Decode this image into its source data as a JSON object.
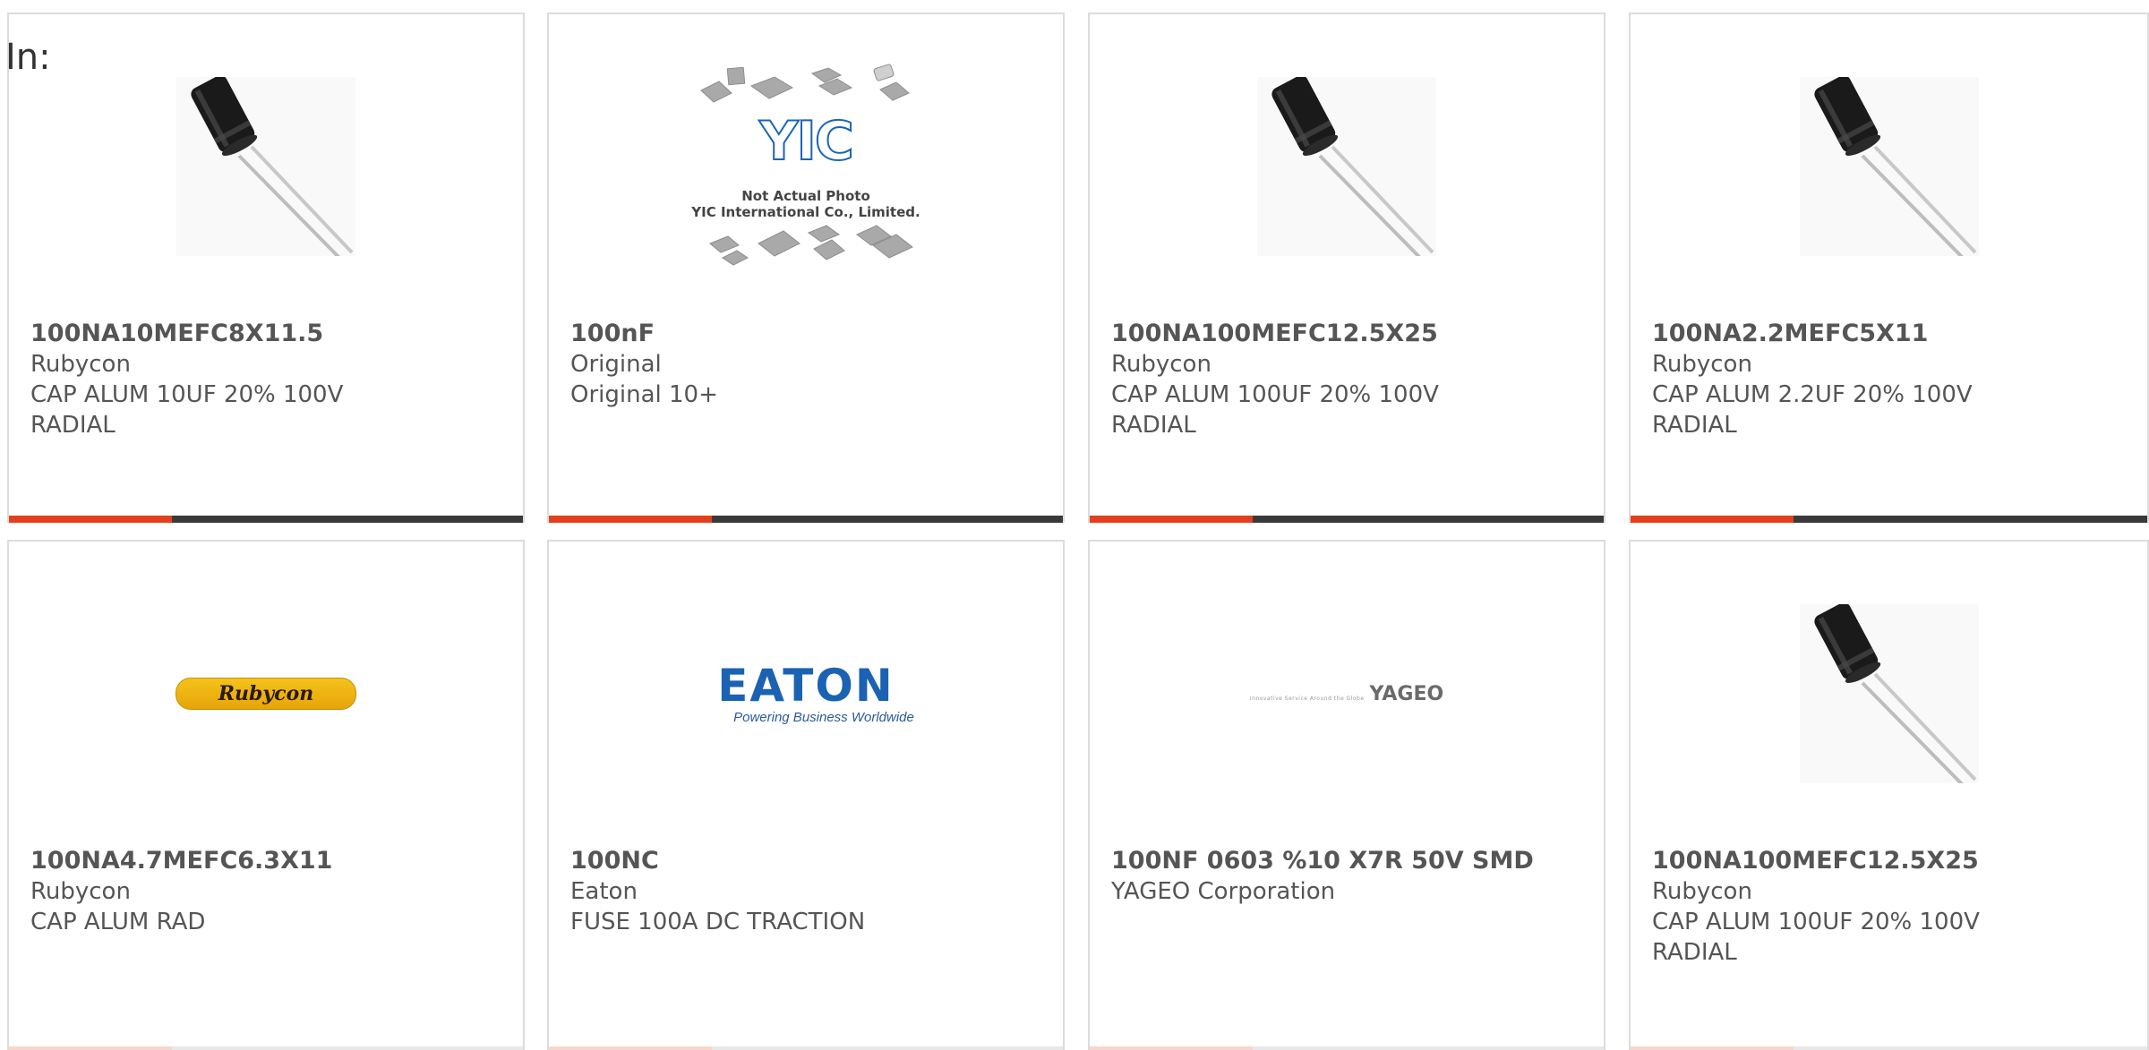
{
  "page": {
    "in_label": "In:"
  },
  "products": [
    {
      "part_number": "100NA10MEFC8X11.5",
      "manufacturer": "Rubycon",
      "description": "CAP ALUM 10UF 20% 100V RADIAL",
      "image": "capacitor-photo"
    },
    {
      "part_number": "100nF",
      "manufacturer": "Original",
      "description": "Original 10+",
      "image": "yic-placeholder",
      "image_text": {
        "logo": "YIC",
        "caption_1": "Not Actual Photo",
        "caption_2": "YIC International Co., Limited."
      }
    },
    {
      "part_number": "100NA100MEFC12.5X25",
      "manufacturer": "Rubycon",
      "description": "CAP ALUM 100UF 20% 100V RADIAL",
      "image": "capacitor-photo"
    },
    {
      "part_number": "100NA2.2MEFC5X11",
      "manufacturer": "Rubycon",
      "description": "CAP ALUM 2.2UF 20% 100V RADIAL",
      "image": "capacitor-photo"
    },
    {
      "part_number": "100NA4.7MEFC6.3X11",
      "manufacturer": "Rubycon",
      "description": "CAP ALUM RAD",
      "image": "rubycon-logo",
      "image_text": {
        "logo": "Rubycon"
      }
    },
    {
      "part_number": "100NC",
      "manufacturer": "Eaton",
      "description": "FUSE 100A DC TRACTION",
      "image": "eaton-logo",
      "image_text": {
        "logo": "EATON",
        "tagline": "Powering Business Worldwide"
      }
    },
    {
      "part_number": "100NF 0603 %10 X7R 50V SMD",
      "manufacturer": "YAGEO Corporation",
      "description": "",
      "image": "yageo-logo",
      "image_text": {
        "logo": "YAGEO",
        "tagline": "Innovative Service Around the Globe"
      }
    },
    {
      "part_number": "100NA100MEFC12.5X25",
      "manufacturer": "Rubycon",
      "description": "CAP ALUM 100UF 20% 100V RADIAL",
      "image": "capacitor-photo"
    }
  ],
  "colors": {
    "accent": "#e2401c",
    "bar": "#3a3a3a",
    "text": "#555555",
    "border": "#dcdcdc"
  }
}
